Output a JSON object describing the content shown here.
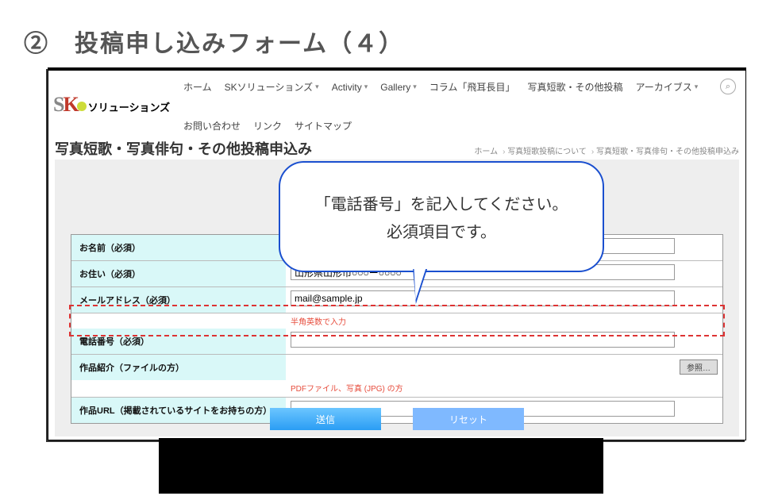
{
  "slide_title": "②　投稿申し込みフォーム（４）",
  "logo": {
    "s": "S",
    "k": "K",
    "jp": "ソリューションズ"
  },
  "nav": {
    "row1": [
      "ホーム",
      "SKソリューションズ",
      "Activity",
      "Gallery",
      "コラム「飛耳長目」",
      "写真短歌・その他投稿",
      "アーカイブス"
    ],
    "dropdown_indices_row1": [
      1,
      2,
      3,
      6
    ],
    "row2": [
      "お問い合わせ",
      "リンク",
      "サイトマップ"
    ]
  },
  "page_title": "写真短歌・写真俳句・その他投稿申込み",
  "crumbs": [
    "ホーム",
    "写真短歌投稿について",
    "写真短歌・写真俳句・その他投稿申込み"
  ],
  "form": {
    "name_label": "お名前（必須）",
    "addr_label": "お住い（必須）",
    "addr_value": "山形県山形市○○○ー○○○○",
    "mail_label": "メールアドレス（必須）",
    "mail_value": "mail@sample.jp",
    "phone_hint": "半角英数で入力",
    "phone_label": "電話番号（必須）",
    "file_label": "作品紹介（ファイルの方）",
    "file_hint": "PDFファイル、写真 (JPG) の方",
    "file_btn": "参照…",
    "url_label": "作品URL（掲載されているサイトをお持ちの方）"
  },
  "balloon": {
    "line1": "「電話番号」を記入してください。",
    "line2": "必須項目です。"
  },
  "buttons": {
    "submit": "送信",
    "reset": "リセット"
  },
  "search_glyph": "⌕"
}
